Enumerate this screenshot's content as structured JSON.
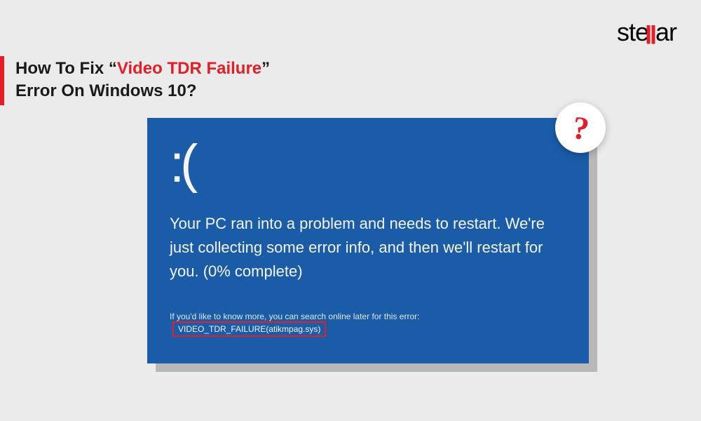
{
  "brand": {
    "name_part1": "ste",
    "name_part2": "ll",
    "name_part3": "ar"
  },
  "title": {
    "line1_prefix": "How To Fix “",
    "line1_highlight": "Video TDR Failure",
    "line1_suffix": "”",
    "line2": "Error On Windows 10?"
  },
  "bsod": {
    "face": ":(",
    "message": "Your PC ran into a problem and needs to restart. We're just collecting some error info, and then we'll restart for you. (0% complete)",
    "sub_prefix": "If you'd like to know more, you can search online later for this error:",
    "error_code": "VIDEO_TDR_FAILURE(atikmpag.sys)"
  },
  "badge": {
    "symbol": "?"
  }
}
